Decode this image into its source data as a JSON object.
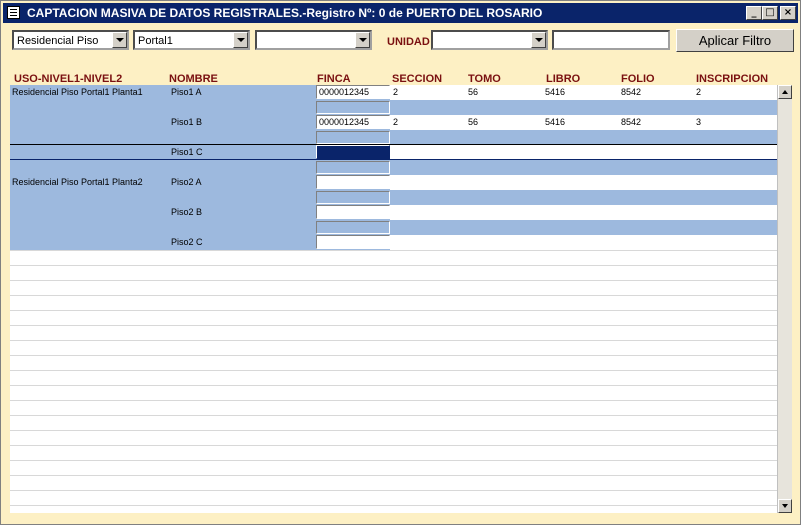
{
  "window": {
    "title": "CAPTACION MASIVA DE DATOS REGISTRALES.-Registro Nº: 0 de PUERTO DEL ROSARIO",
    "minimize": "_",
    "maximize": "□",
    "close": "×"
  },
  "filters": {
    "uso": "Residencial Piso",
    "nivel1": "Portal1",
    "nivel2": "",
    "unidad_label": "UNIDAD",
    "unidad": "",
    "search": "",
    "apply_label": "Aplicar Filtro"
  },
  "columns": {
    "uso": "USO-NIVEL1-NIVEL2",
    "nombre": "NOMBRE",
    "finca": "FINCA",
    "seccion": "SECCION",
    "tomo": "TOMO",
    "libro": "LIBRO",
    "folio": "FOLIO",
    "inscripcion": "INSCRIPCION"
  },
  "rows": [
    {
      "uso": "Residencial Piso Portal1 Planta1",
      "nombre": "Piso1 A",
      "finca": "0000012345",
      "seccion": "2",
      "tomo": "56",
      "libro": "5416",
      "folio": "8542",
      "inscripcion": "2"
    },
    {
      "uso": "",
      "nombre": "Piso1 B",
      "finca": "0000012345",
      "seccion": "2",
      "tomo": "56",
      "libro": "5416",
      "folio": "8542",
      "inscripcion": "3"
    },
    {
      "uso": "",
      "nombre": "Piso1 C",
      "finca": "",
      "seccion": "",
      "tomo": "",
      "libro": "",
      "folio": "",
      "inscripcion": ""
    },
    {
      "uso": "Residencial Piso Portal1 Planta2",
      "nombre": "Piso2 A",
      "finca": "",
      "seccion": "",
      "tomo": "",
      "libro": "",
      "folio": "",
      "inscripcion": ""
    },
    {
      "uso": "",
      "nombre": "Piso2 B",
      "finca": "",
      "seccion": "",
      "tomo": "",
      "libro": "",
      "folio": "",
      "inscripcion": ""
    },
    {
      "uso": "",
      "nombre": "Piso2 C",
      "finca": "",
      "seccion": "",
      "tomo": "",
      "libro": "",
      "folio": "",
      "inscripcion": ""
    }
  ],
  "colors": {
    "band": "#9DB9DE",
    "title_bar": "#0A246A",
    "header_text": "#7a1010",
    "window_bg": "#FDF0C4"
  }
}
